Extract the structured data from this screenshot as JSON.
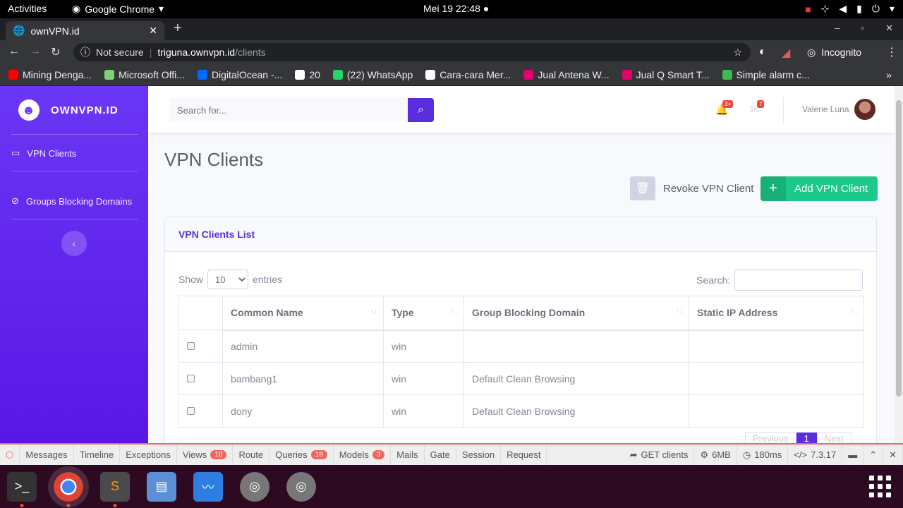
{
  "system": {
    "activities": "Activities",
    "app": "Google Chrome",
    "clock": "Mei 19  22:48"
  },
  "browser": {
    "tab_title": "ownVPN.id",
    "not_secure": "Not secure",
    "url_host": "triguna.ownvpn.id",
    "url_path": "/clients",
    "profile": "Incognito",
    "bookmarks": [
      {
        "label": "Mining Denga...",
        "color": "#ff0000"
      },
      {
        "label": "Microsoft Offi...",
        "color": "#7cd175"
      },
      {
        "label": "DigitalOcean -...",
        "color": "#0069ff"
      },
      {
        "label": "20",
        "color": "#ffffff"
      },
      {
        "label": "(22) WhatsApp",
        "color": "#25d366"
      },
      {
        "label": "Cara-cara Mer...",
        "color": "#ffffff"
      },
      {
        "label": "Jual Antena W...",
        "color": "#e4006f"
      },
      {
        "label": "Jual Q Smart T...",
        "color": "#e4006f"
      },
      {
        "label": "Simple alarm c...",
        "color": "#3fb950"
      }
    ]
  },
  "sidebar": {
    "brand": "OWNVPN.ID",
    "items": [
      {
        "label": "VPN Clients",
        "icon": "laptop-icon"
      },
      {
        "label": "Groups Blocking Domains",
        "icon": "ban-icon"
      }
    ]
  },
  "topnav": {
    "search_placeholder": "Search for...",
    "alerts_count": "3+",
    "messages_count": "7",
    "user": "Valerie Luna"
  },
  "page": {
    "title": "VPN Clients",
    "revoke_label": "Revoke VPN Client",
    "add_label": "Add VPN Client"
  },
  "card": {
    "title": "VPN Clients List",
    "show": "Show",
    "entries": "entries",
    "page_length": "10",
    "search_label": "Search:",
    "columns": [
      "Common Name",
      "Type",
      "Group Blocking Domain",
      "Static IP Address"
    ],
    "rows": [
      [
        "admin",
        "win",
        "",
        ""
      ],
      [
        "bambang1",
        "win",
        "Default Clean Browsing",
        ""
      ],
      [
        "dony",
        "win",
        "Default Clean Browsing",
        ""
      ]
    ],
    "pagination": {
      "prev": "Previous",
      "current": "1",
      "next": "Next"
    }
  },
  "debugbar": {
    "items": [
      {
        "label": "Messages"
      },
      {
        "label": "Timeline"
      },
      {
        "label": "Exceptions"
      },
      {
        "label": "Views",
        "count": "10"
      },
      {
        "label": "Route"
      },
      {
        "label": "Queries",
        "count": "18"
      },
      {
        "label": "Models",
        "count": "3"
      },
      {
        "label": "Mails"
      },
      {
        "label": "Gate"
      },
      {
        "label": "Session"
      },
      {
        "label": "Request"
      }
    ],
    "route": "GET clients",
    "memory": "6MB",
    "time": "180ms",
    "php": "7.3.17"
  }
}
